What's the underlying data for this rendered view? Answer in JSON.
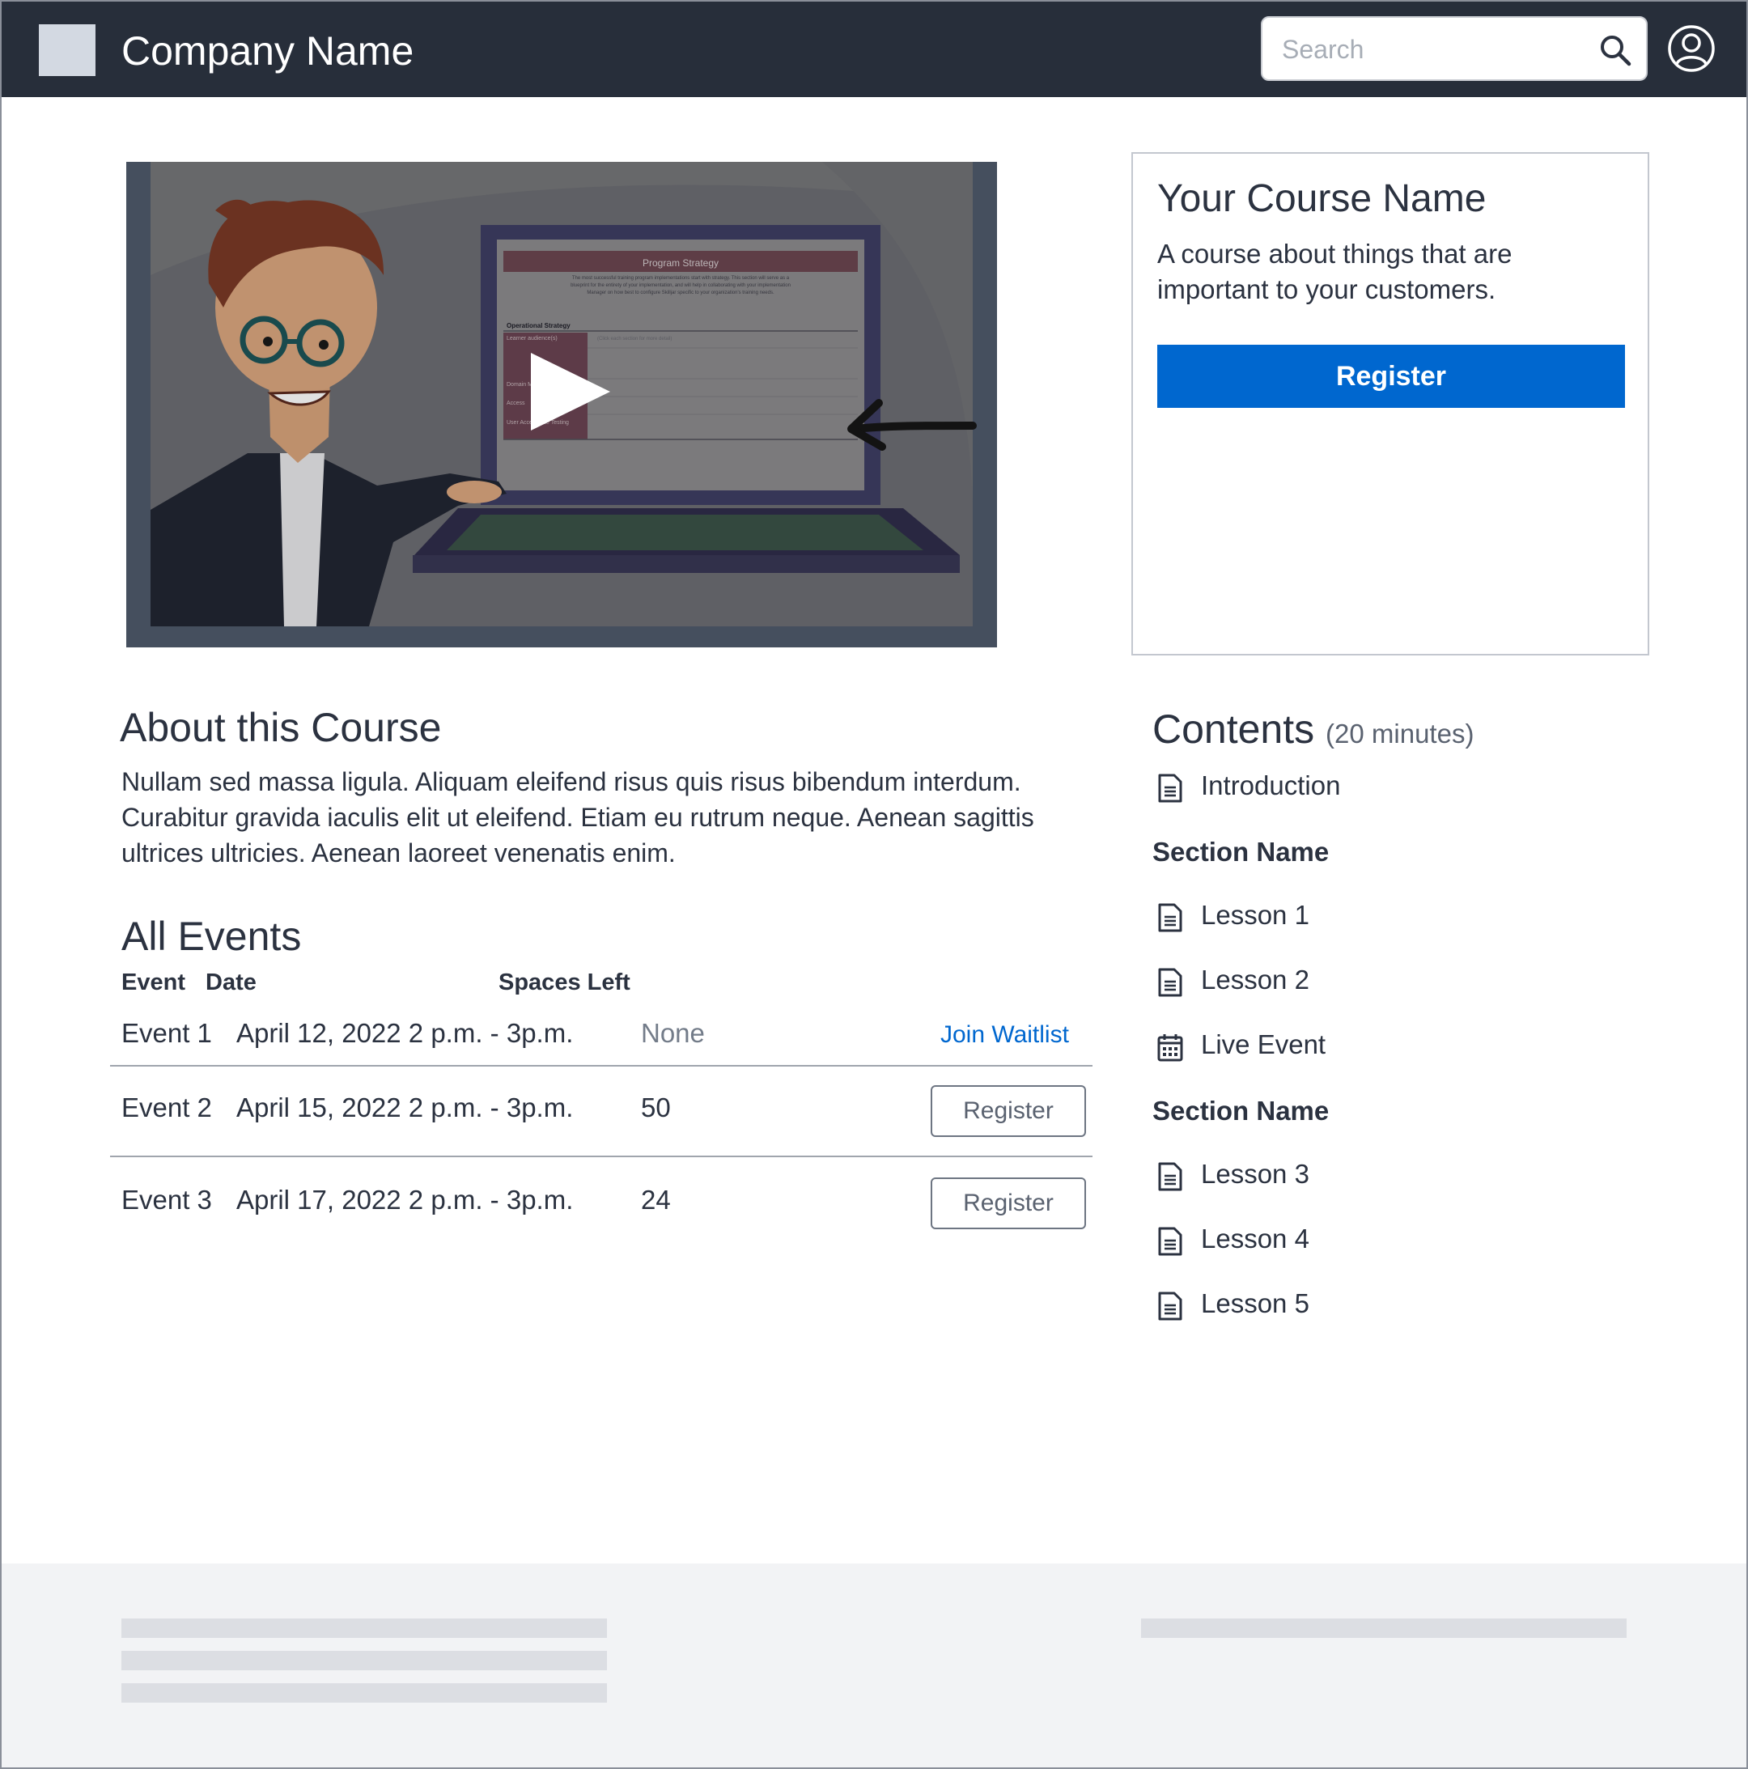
{
  "header": {
    "company_name": "Company Name",
    "search_placeholder": "Search"
  },
  "video": {
    "slide_title": "Program Strategy",
    "slide_text_1": "The most successful training program implementations start with strategy. This section will serve as a",
    "slide_text_2": "blueprint for the entirety of your implementation, and will help in collaborating with your implementation",
    "slide_text_3": "Manager on how best to configure Skilljar specific to your organization's training needs.",
    "slide_section": "Operational Strategy",
    "slide_row_1": "Learner audience(s)",
    "slide_row_1_note": "(Click each section for more detail)",
    "slide_row_2": "Domain Model",
    "slide_row_3": "Access",
    "slide_row_4": "User Acceptance Testing"
  },
  "course_card": {
    "title": "Your Course Name",
    "description": "A course about things that are important to your customers.",
    "register_label": "Register"
  },
  "about": {
    "heading": "About this Course",
    "text": "Nullam sed massa ligula. Aliquam eleifend risus quis risus bibendum interdum. Curabitur gravida iaculis elit ut eleifend. Etiam eu rutrum neque. Aenean sagittis ultrices ultricies. Aenean laoreet venenatis enim."
  },
  "events": {
    "heading": "All Events",
    "columns": {
      "event": "Event",
      "date": "Date",
      "spaces": "Spaces Left"
    },
    "rows": [
      {
        "event": "Event 1",
        "date": "April 12, 2022 2 p.m. - 3p.m.",
        "spaces": "None",
        "action": "Join Waitlist"
      },
      {
        "event": "Event 2",
        "date": "April 15, 2022 2 p.m. - 3p.m.",
        "spaces": "50",
        "action": "Register"
      },
      {
        "event": "Event 3",
        "date": "April 17, 2022 2 p.m. - 3p.m.",
        "spaces": "24",
        "action": "Register"
      }
    ]
  },
  "contents": {
    "heading": "Contents",
    "duration": "(20 minutes)",
    "intro": {
      "label": "Introduction",
      "icon": "document-icon"
    },
    "sections": [
      {
        "name": "Section Name",
        "items": [
          {
            "label": "Lesson 1",
            "icon": "document-icon"
          },
          {
            "label": "Lesson 2",
            "icon": "document-icon"
          },
          {
            "label": "Live Event",
            "icon": "calendar-icon"
          }
        ]
      },
      {
        "name": "Section Name",
        "items": [
          {
            "label": "Lesson 3",
            "icon": "document-icon"
          },
          {
            "label": "Lesson 4",
            "icon": "document-icon"
          },
          {
            "label": "Lesson 5",
            "icon": "document-icon"
          }
        ]
      }
    ]
  },
  "colors": {
    "header_bg": "#272e3a",
    "primary": "#0067cf",
    "footer_bg": "#f2f3f5"
  }
}
